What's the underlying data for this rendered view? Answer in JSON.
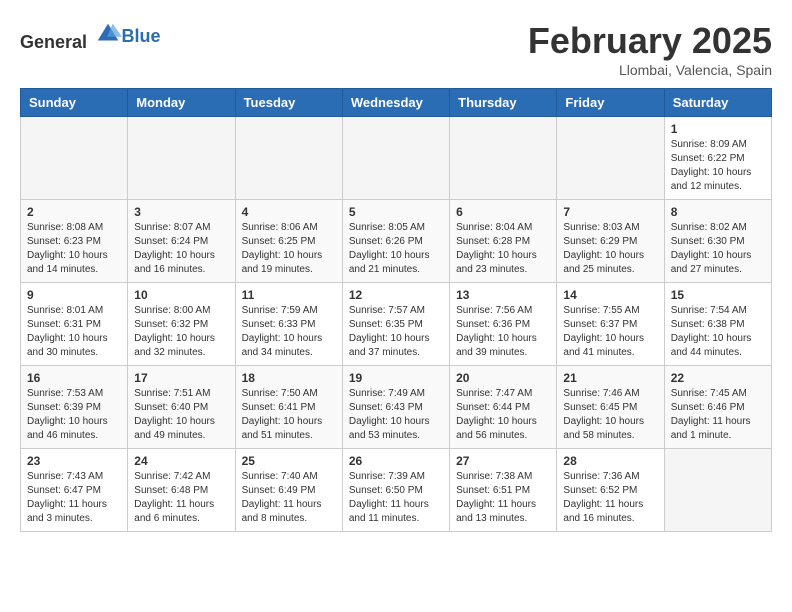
{
  "logo": {
    "general": "General",
    "blue": "Blue"
  },
  "header": {
    "title": "February 2025",
    "subtitle": "Llombai, Valencia, Spain"
  },
  "weekdays": [
    "Sunday",
    "Monday",
    "Tuesday",
    "Wednesday",
    "Thursday",
    "Friday",
    "Saturday"
  ],
  "weeks": [
    [
      {
        "day": "",
        "info": ""
      },
      {
        "day": "",
        "info": ""
      },
      {
        "day": "",
        "info": ""
      },
      {
        "day": "",
        "info": ""
      },
      {
        "day": "",
        "info": ""
      },
      {
        "day": "",
        "info": ""
      },
      {
        "day": "1",
        "info": "Sunrise: 8:09 AM\nSunset: 6:22 PM\nDaylight: 10 hours and 12 minutes."
      }
    ],
    [
      {
        "day": "2",
        "info": "Sunrise: 8:08 AM\nSunset: 6:23 PM\nDaylight: 10 hours and 14 minutes."
      },
      {
        "day": "3",
        "info": "Sunrise: 8:07 AM\nSunset: 6:24 PM\nDaylight: 10 hours and 16 minutes."
      },
      {
        "day": "4",
        "info": "Sunrise: 8:06 AM\nSunset: 6:25 PM\nDaylight: 10 hours and 19 minutes."
      },
      {
        "day": "5",
        "info": "Sunrise: 8:05 AM\nSunset: 6:26 PM\nDaylight: 10 hours and 21 minutes."
      },
      {
        "day": "6",
        "info": "Sunrise: 8:04 AM\nSunset: 6:28 PM\nDaylight: 10 hours and 23 minutes."
      },
      {
        "day": "7",
        "info": "Sunrise: 8:03 AM\nSunset: 6:29 PM\nDaylight: 10 hours and 25 minutes."
      },
      {
        "day": "8",
        "info": "Sunrise: 8:02 AM\nSunset: 6:30 PM\nDaylight: 10 hours and 27 minutes."
      }
    ],
    [
      {
        "day": "9",
        "info": "Sunrise: 8:01 AM\nSunset: 6:31 PM\nDaylight: 10 hours and 30 minutes."
      },
      {
        "day": "10",
        "info": "Sunrise: 8:00 AM\nSunset: 6:32 PM\nDaylight: 10 hours and 32 minutes."
      },
      {
        "day": "11",
        "info": "Sunrise: 7:59 AM\nSunset: 6:33 PM\nDaylight: 10 hours and 34 minutes."
      },
      {
        "day": "12",
        "info": "Sunrise: 7:57 AM\nSunset: 6:35 PM\nDaylight: 10 hours and 37 minutes."
      },
      {
        "day": "13",
        "info": "Sunrise: 7:56 AM\nSunset: 6:36 PM\nDaylight: 10 hours and 39 minutes."
      },
      {
        "day": "14",
        "info": "Sunrise: 7:55 AM\nSunset: 6:37 PM\nDaylight: 10 hours and 41 minutes."
      },
      {
        "day": "15",
        "info": "Sunrise: 7:54 AM\nSunset: 6:38 PM\nDaylight: 10 hours and 44 minutes."
      }
    ],
    [
      {
        "day": "16",
        "info": "Sunrise: 7:53 AM\nSunset: 6:39 PM\nDaylight: 10 hours and 46 minutes."
      },
      {
        "day": "17",
        "info": "Sunrise: 7:51 AM\nSunset: 6:40 PM\nDaylight: 10 hours and 49 minutes."
      },
      {
        "day": "18",
        "info": "Sunrise: 7:50 AM\nSunset: 6:41 PM\nDaylight: 10 hours and 51 minutes."
      },
      {
        "day": "19",
        "info": "Sunrise: 7:49 AM\nSunset: 6:43 PM\nDaylight: 10 hours and 53 minutes."
      },
      {
        "day": "20",
        "info": "Sunrise: 7:47 AM\nSunset: 6:44 PM\nDaylight: 10 hours and 56 minutes."
      },
      {
        "day": "21",
        "info": "Sunrise: 7:46 AM\nSunset: 6:45 PM\nDaylight: 10 hours and 58 minutes."
      },
      {
        "day": "22",
        "info": "Sunrise: 7:45 AM\nSunset: 6:46 PM\nDaylight: 11 hours and 1 minute."
      }
    ],
    [
      {
        "day": "23",
        "info": "Sunrise: 7:43 AM\nSunset: 6:47 PM\nDaylight: 11 hours and 3 minutes."
      },
      {
        "day": "24",
        "info": "Sunrise: 7:42 AM\nSunset: 6:48 PM\nDaylight: 11 hours and 6 minutes."
      },
      {
        "day": "25",
        "info": "Sunrise: 7:40 AM\nSunset: 6:49 PM\nDaylight: 11 hours and 8 minutes."
      },
      {
        "day": "26",
        "info": "Sunrise: 7:39 AM\nSunset: 6:50 PM\nDaylight: 11 hours and 11 minutes."
      },
      {
        "day": "27",
        "info": "Sunrise: 7:38 AM\nSunset: 6:51 PM\nDaylight: 11 hours and 13 minutes."
      },
      {
        "day": "28",
        "info": "Sunrise: 7:36 AM\nSunset: 6:52 PM\nDaylight: 11 hours and 16 minutes."
      },
      {
        "day": "",
        "info": ""
      }
    ]
  ]
}
